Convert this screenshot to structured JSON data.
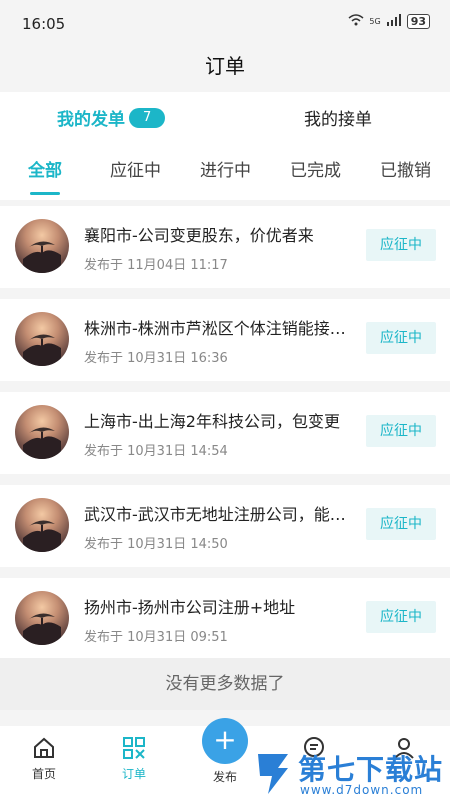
{
  "status_bar": {
    "time": "16:05",
    "network": "5G",
    "battery": "93"
  },
  "header": {
    "title": "订单"
  },
  "top_switch": {
    "mine_label": "我的发单",
    "mine_count": "7",
    "taken_label": "我的接单"
  },
  "tabs": [
    "全部",
    "应征中",
    "进行中",
    "已完成",
    "已撤销"
  ],
  "orders": [
    {
      "title": "襄阳市-公司变更股东，价优者来",
      "time": "发布于 11月04日 11:17",
      "status": "应征中"
    },
    {
      "title": "株洲市-株洲市芦淞区个体注销能接…",
      "time": "发布于 10月31日 16:36",
      "status": "应征中"
    },
    {
      "title": "上海市-出上海2年科技公司，包变更",
      "time": "发布于 10月31日 14:54",
      "status": "应征中"
    },
    {
      "title": "武汉市-武汉市无地址注册公司，能…",
      "time": "发布于 10月31日 14:50",
      "status": "应征中"
    },
    {
      "title": "扬州市-扬州市公司注册+地址",
      "time": "发布于 10月31日 09:51",
      "status": "应征中"
    }
  ],
  "list_end": "没有更多数据了",
  "bottom_nav": {
    "home": "首页",
    "orders": "订单",
    "publish": "发布",
    "publish_icon": "+"
  },
  "watermark": {
    "name": "第七下载站",
    "url": "www.d7down.com"
  },
  "colors": {
    "accent": "#1cb6c8",
    "publish": "#3aa2e6"
  }
}
